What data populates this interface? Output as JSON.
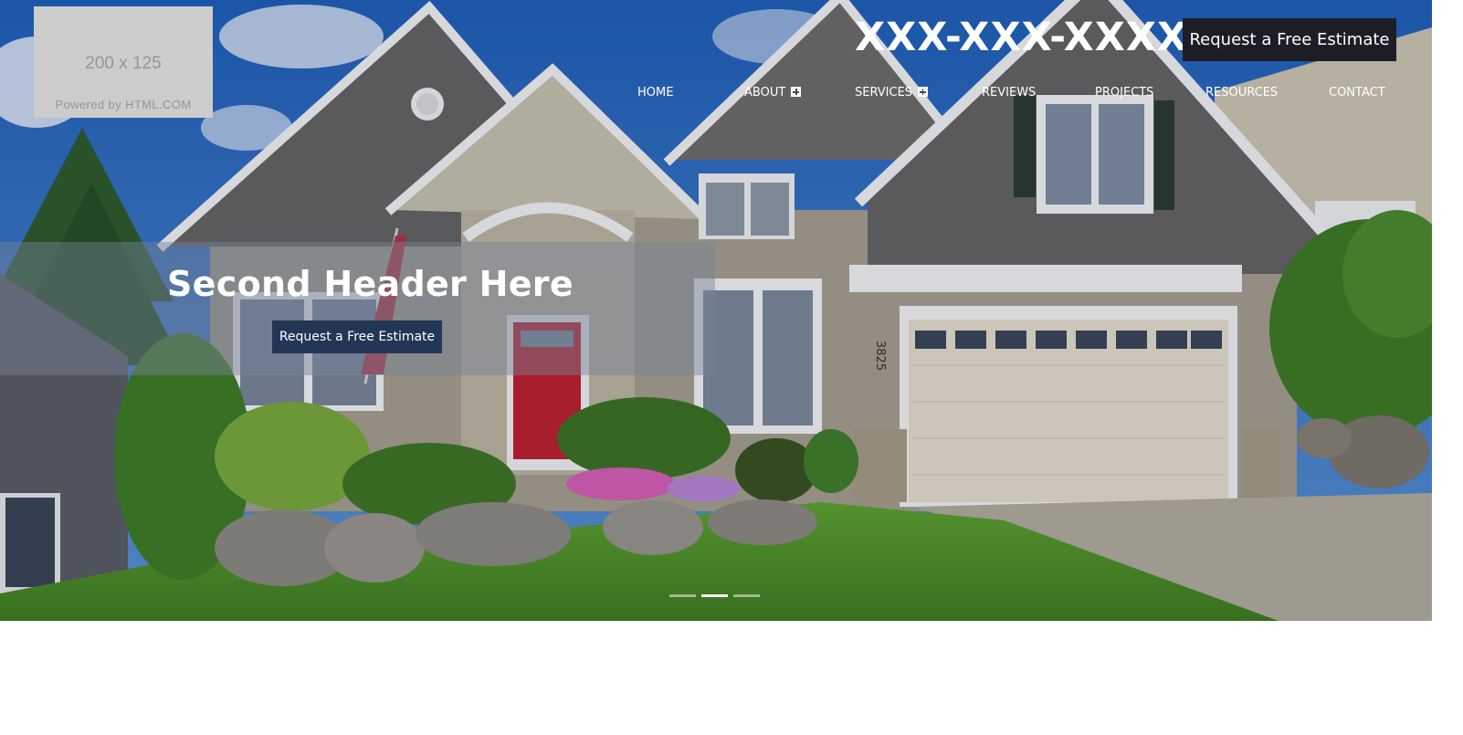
{
  "logo": {
    "size_text": "200 x 125",
    "powered_text": "Powered by HTML.COM"
  },
  "header": {
    "phone": "XXX-XXX-XXXX",
    "estimate_button": "Request a Free Estimate"
  },
  "nav": {
    "items": [
      {
        "label": "HOME",
        "has_submenu": false
      },
      {
        "label": "ABOUT",
        "has_submenu": true
      },
      {
        "label": "SERVICES",
        "has_submenu": true
      },
      {
        "label": "REVIEWS",
        "has_submenu": false
      },
      {
        "label": "PROJECTS",
        "has_submenu": false
      },
      {
        "label": "RESOURCES",
        "has_submenu": false
      },
      {
        "label": "CONTACT",
        "has_submenu": false
      }
    ]
  },
  "hero": {
    "heading": "Second Header Here",
    "button_label": "Request a Free Estimate",
    "house_number": "3825",
    "slides": {
      "count": 3,
      "active_index": 1
    }
  },
  "colors": {
    "top_button_bg": "#1d1e25",
    "hero_button_bg": "#233656",
    "door_red": "#c0202c"
  }
}
